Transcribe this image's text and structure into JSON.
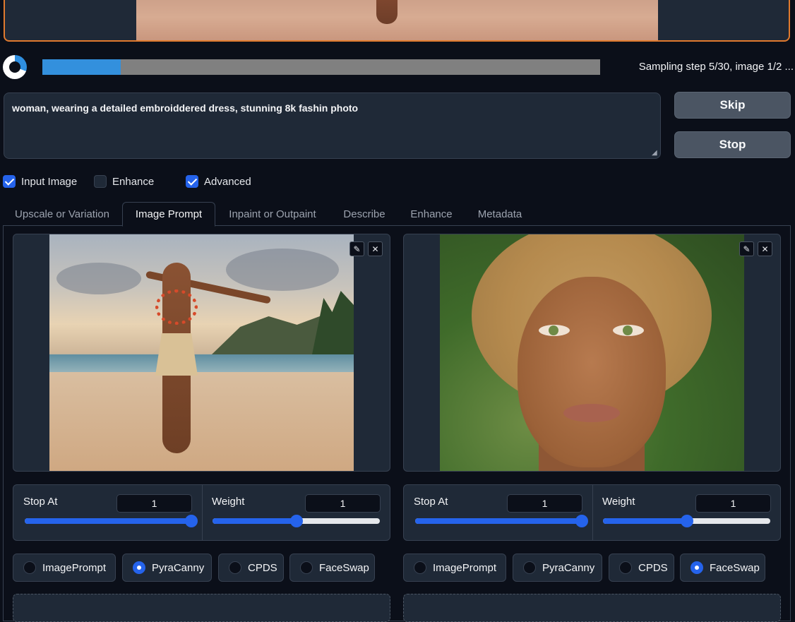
{
  "progress": {
    "percent": 14,
    "status_text": "Sampling step 5/30, image 1/2 ..."
  },
  "prompt": {
    "value": "woman, wearing a detailed embroiddered dress, stunning 8k fashin photo"
  },
  "buttons": {
    "skip": "Skip",
    "stop": "Stop"
  },
  "options": [
    {
      "label": "Input Image",
      "checked": true
    },
    {
      "label": "Enhance",
      "checked": false
    },
    {
      "label": "Advanced",
      "checked": true
    }
  ],
  "tabs": [
    {
      "label": "Upscale or Variation",
      "active": false
    },
    {
      "label": "Image Prompt",
      "active": true
    },
    {
      "label": "Inpaint or Outpaint",
      "active": false
    },
    {
      "label": "Describe",
      "active": false
    },
    {
      "label": "Enhance",
      "active": false
    },
    {
      "label": "Metadata",
      "active": false
    }
  ],
  "image_prompts": [
    {
      "image": "beach-dancer-photo",
      "stop_at": {
        "label": "Stop At",
        "value": "1",
        "fraction": 1.0
      },
      "weight": {
        "label": "Weight",
        "value": "1",
        "fraction": 0.5
      },
      "types": [
        {
          "label": "ImagePrompt",
          "selected": false
        },
        {
          "label": "PyraCanny",
          "selected": true
        },
        {
          "label": "CPDS",
          "selected": false
        },
        {
          "label": "FaceSwap",
          "selected": false
        }
      ]
    },
    {
      "image": "portrait-photo",
      "stop_at": {
        "label": "Stop At",
        "value": "1",
        "fraction": 1.0
      },
      "weight": {
        "label": "Weight",
        "value": "1",
        "fraction": 0.5
      },
      "types": [
        {
          "label": "ImagePrompt",
          "selected": false
        },
        {
          "label": "PyraCanny",
          "selected": false
        },
        {
          "label": "CPDS",
          "selected": false
        },
        {
          "label": "FaceSwap",
          "selected": true
        }
      ]
    }
  ],
  "icons": {
    "edit": "pencil-icon",
    "clear": "close-icon"
  },
  "colors": {
    "accent": "#2563eb",
    "progress": "#3390dd",
    "preview_border": "#e07a2e"
  }
}
